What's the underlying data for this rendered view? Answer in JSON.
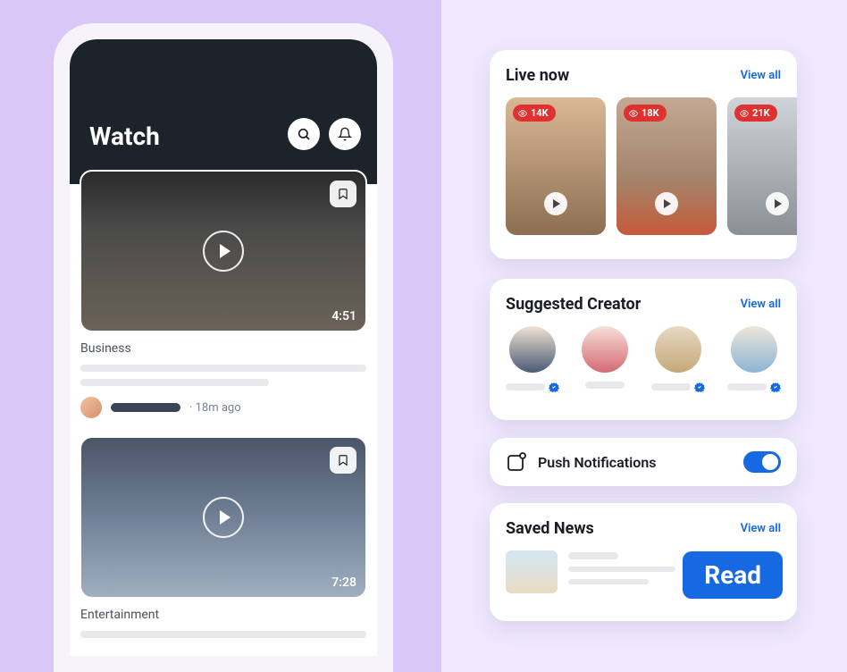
{
  "phone": {
    "title": "Watch",
    "videos": [
      {
        "category": "Business",
        "duration": "4:51",
        "time_ago": "· 18m ago"
      },
      {
        "category": "Entertainment",
        "duration": "7:28"
      }
    ]
  },
  "live": {
    "title": "Live now",
    "view_all": "View all",
    "items": [
      {
        "viewers": "14K"
      },
      {
        "viewers": "18K"
      },
      {
        "viewers": "21K"
      }
    ]
  },
  "creators": {
    "title": "Suggested Creator",
    "view_all": "View all",
    "items": [
      {
        "verified": true
      },
      {
        "verified": false
      },
      {
        "verified": true
      },
      {
        "verified": true
      }
    ]
  },
  "push": {
    "label": "Push Notifications",
    "enabled": true
  },
  "saved": {
    "title": "Saved News",
    "view_all": "View all",
    "read_label": "Read"
  },
  "colors": {
    "accent": "#1668e3",
    "danger": "#e03131"
  }
}
